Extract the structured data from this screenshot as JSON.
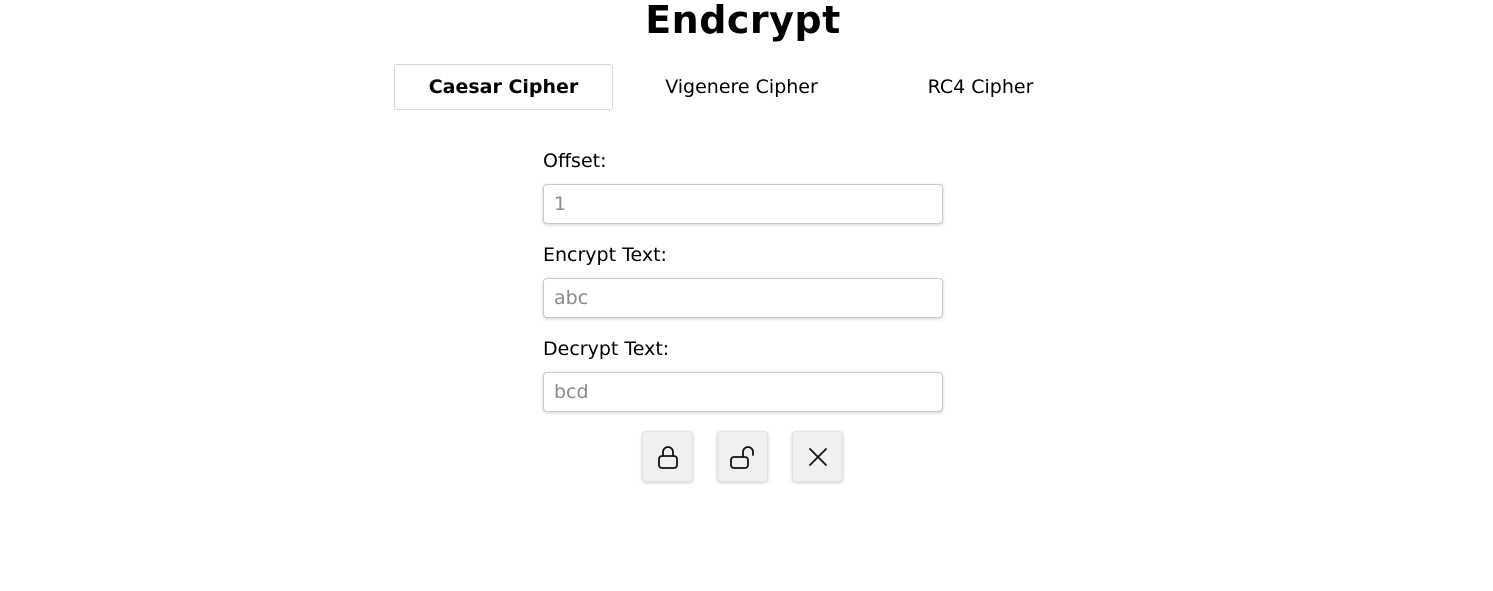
{
  "header": {
    "title": "Endcrypt"
  },
  "tabs": [
    {
      "label": "Caesar Cipher",
      "active": true
    },
    {
      "label": "Vigenere Cipher",
      "active": false
    },
    {
      "label": "RC4 Cipher",
      "active": false
    }
  ],
  "form": {
    "offset": {
      "label": "Offset:",
      "placeholder": "1"
    },
    "encrypt": {
      "label": "Encrypt Text:",
      "placeholder": "abc"
    },
    "decrypt": {
      "label": "Decrypt Text:",
      "placeholder": "bcd"
    }
  },
  "actions": {
    "encrypt_icon": "lock-icon",
    "decrypt_icon": "unlock-icon",
    "clear_icon": "close-icon"
  },
  "colors": {
    "background": "#ffffff",
    "text": "#000000",
    "button_bg": "#f0f0f0",
    "border": "#d3d3d3"
  }
}
